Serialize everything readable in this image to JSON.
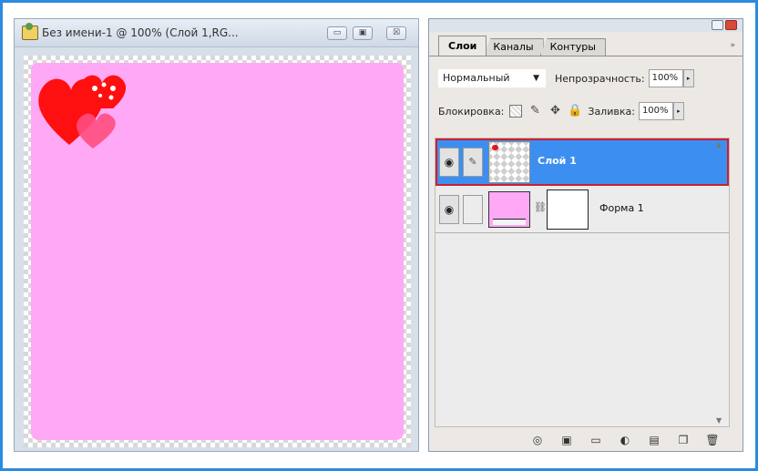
{
  "document": {
    "title": "Без имени-1 @ 100% (Слой 1,RG...",
    "buttons": {
      "minimize": "▭",
      "maximize": "▣",
      "close": "☒"
    }
  },
  "canvas": {
    "fill_color": "#ffa8f5",
    "heart_color": "#ff1010",
    "heart_pink": "#ff4d80"
  },
  "panel": {
    "tabs": [
      "Слои",
      "Каналы",
      "Контуры"
    ],
    "menu_arrow": "»",
    "blend_mode": "Нормальный",
    "opacity_label": "Непрозрачность:",
    "opacity_value": "100%",
    "lock_label": "Блокировка:",
    "fill_label": "Заливка:",
    "fill_value": "100%",
    "layers": [
      {
        "name": "Слой 1",
        "selected": true
      },
      {
        "name": "Форма 1",
        "selected": false
      }
    ],
    "footer_icons": [
      "link-icon",
      "fx-icon",
      "mask-icon",
      "adjustment-icon",
      "folder-icon",
      "new-layer-icon",
      "trash-icon"
    ]
  },
  "colors": {
    "accent_blue": "#3c8ff0",
    "selection_outline": "#cc1f2e",
    "frame": "#2a8be0"
  }
}
